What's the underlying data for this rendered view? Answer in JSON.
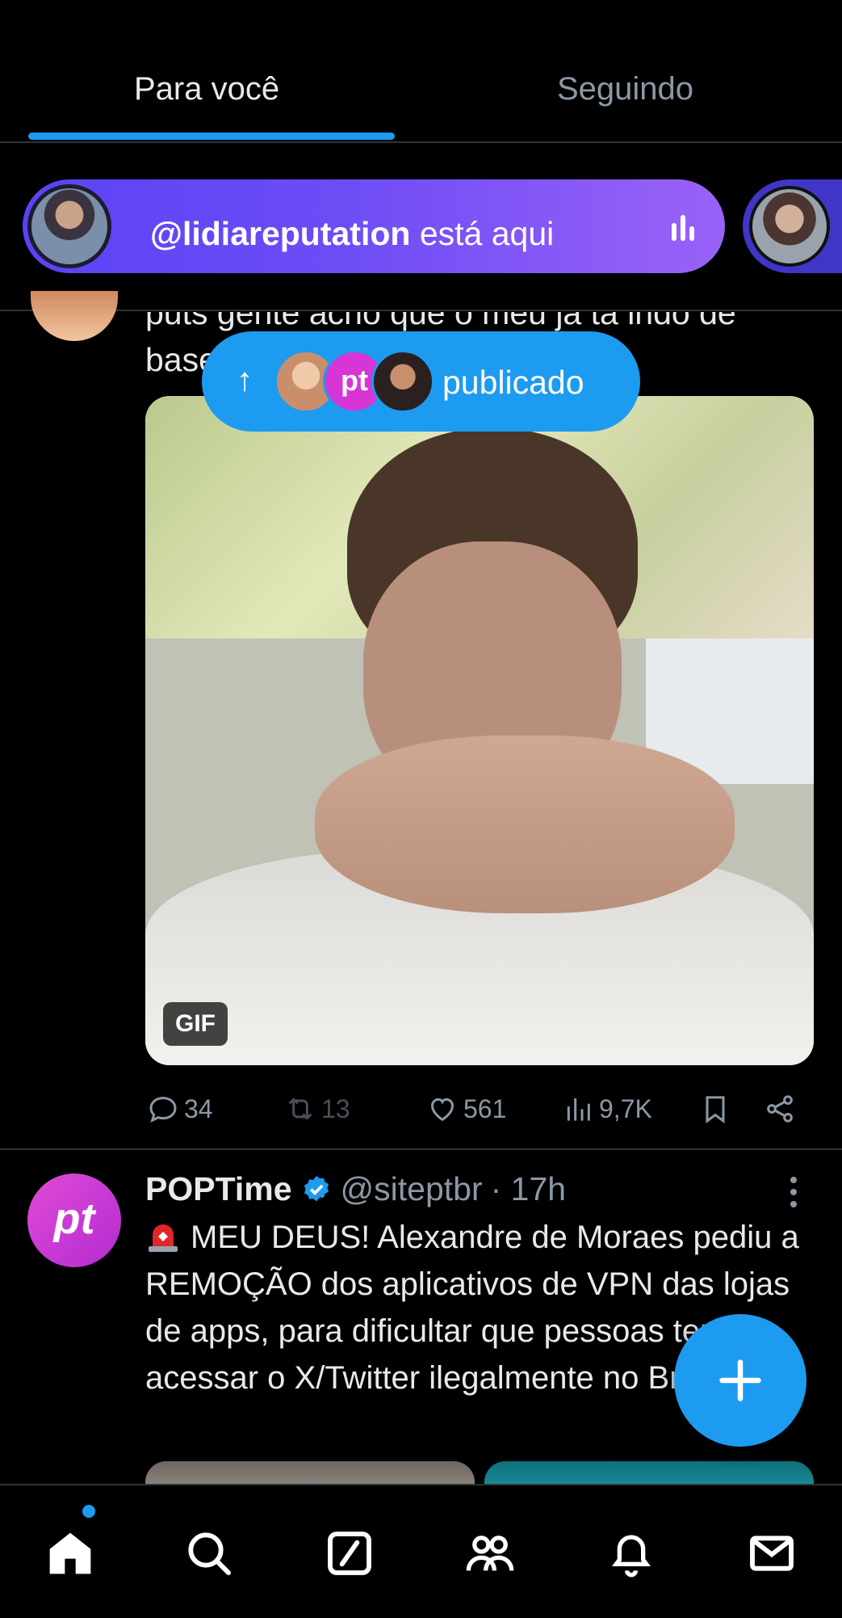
{
  "tabs": {
    "for_you": "Para você",
    "following": "Seguindo"
  },
  "space": {
    "host": "@lidiareputation",
    "status": " está aqui"
  },
  "partial_tweet": {
    "text_line1": "puts gente acho que o meu ja ta indo de",
    "text_line2": "base"
  },
  "new_posts_pill": {
    "label": "publicado",
    "avatar2_text": "pt"
  },
  "media": {
    "badge": "GIF"
  },
  "actions": {
    "replies": "34",
    "reposts": "13",
    "likes": "561",
    "views": "9,7K"
  },
  "tweet2": {
    "avatar_text": "pt",
    "name": "POPTime",
    "handle": "@siteptbr",
    "time": "· 17h",
    "body": "MEU DEUS! Alexandre de Moraes pediu a REMOÇÃO dos aplicativos de VPN das lojas de apps, para dificultar que pessoas tentem acessar o X/Twitter ilegalmente no Brasil."
  },
  "icons": {
    "reply": "reply-icon",
    "repost": "repost-icon",
    "like": "heart-icon",
    "views": "views-icon",
    "bookmark": "bookmark-icon",
    "share": "share-icon",
    "compose": "plus-icon",
    "nav": [
      "home-icon",
      "search-icon",
      "grok-icon",
      "communities-icon",
      "bell-icon",
      "mail-icon"
    ]
  },
  "colors": {
    "accent": "#1d9bf0",
    "background": "#000000",
    "text": "#e7e9ea",
    "muted": "#8b98a5",
    "space_gradient_start": "#5a43f5",
    "space_gradient_end": "#9a62f7"
  }
}
